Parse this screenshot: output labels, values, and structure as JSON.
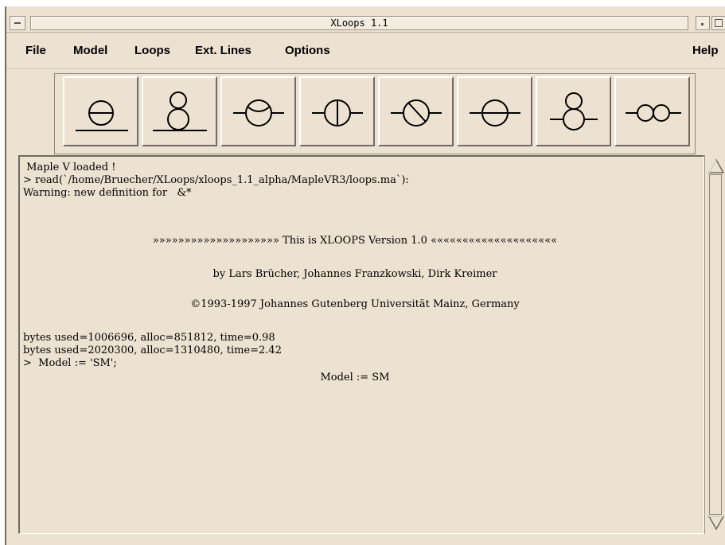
{
  "window": {
    "title": "XLoops 1.1"
  },
  "menu": {
    "file": "File",
    "model": "Model",
    "loops": "Loops",
    "ext_lines": "Ext. Lines",
    "options": "Options",
    "help": "Help"
  },
  "toolbar": {
    "buttons": [
      {
        "icon": "two-loop-sunset-diagram-icon"
      },
      {
        "icon": "two-loop-double-bubble-diagram-icon"
      },
      {
        "icon": "two-point-bubble-vertex-diagram-icon"
      },
      {
        "icon": "two-loop-master-diagram-icon"
      },
      {
        "icon": "two-loop-vertex-correction-diagram-icon"
      },
      {
        "icon": "two-loop-sunset-external-diagram-icon"
      },
      {
        "icon": "two-loop-figure-eight-diagram-icon"
      },
      {
        "icon": "two-loop-chain-diagram-icon"
      }
    ]
  },
  "output": {
    "line1": " Maple V loaded !",
    "line2": "> read(`/home/Bruecher/XLoops/xloops_1.1_alpha/MapleVR3/loops.ma`):",
    "line3": "Warning: new definition for   &*",
    "banner": "»»»»»»»»»»»»»»»»»»»» This is XLOOPS Version 1.0 ««««««««««««««««««««",
    "authors": "by Lars Brücher, Johannes Franzkowski, Dirk Kreimer",
    "copyright": "©1993-1997 Johannes Gutenberg Universität Mainz, Germany",
    "bytes1": "bytes used=1006696, alloc=851812, time=0.98",
    "bytes2": "bytes used=2020300, alloc=1310480, time=2.42",
    "prompt": ">  Model := 'SM';",
    "result": "Model := SM"
  }
}
